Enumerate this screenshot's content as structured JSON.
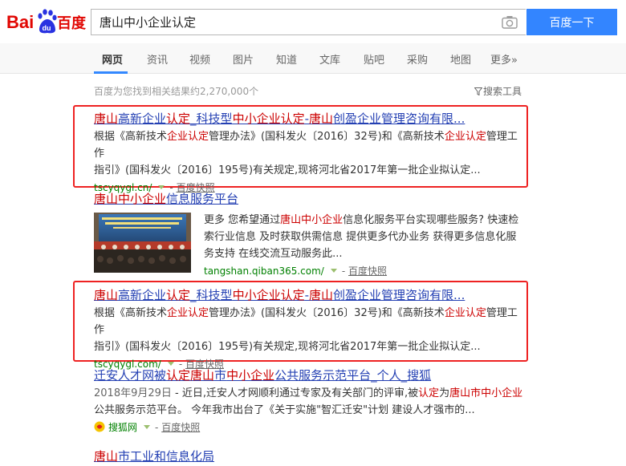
{
  "header": {
    "logo_text_left": "Bai",
    "logo_text_du": "du",
    "logo_text_right": "百度",
    "query": "唐山中小企业认定",
    "search_button": "百度一下"
  },
  "tabs": [
    {
      "label": "网页",
      "active": true
    },
    {
      "label": "资讯"
    },
    {
      "label": "视频"
    },
    {
      "label": "图片"
    },
    {
      "label": "知道"
    },
    {
      "label": "文库"
    },
    {
      "label": "贴吧"
    },
    {
      "label": "采购"
    },
    {
      "label": "地图"
    },
    {
      "label": "更多»"
    }
  ],
  "meta": {
    "result_count": "百度为您找到相关结果约2,270,000个",
    "search_tools": "搜索工具"
  },
  "results": [
    {
      "title_parts": [
        "唐山",
        "高新企业",
        "认定",
        "_科技型",
        "中小企业",
        "认定",
        "-",
        "唐山",
        "创盈企业管理咨询有限..."
      ],
      "abstract_line1": [
        "根据《高新技术",
        "企业认定",
        "管理办法》(国科发火〔2016〕32号)和《高新技术",
        "企业认定",
        "管理工作"
      ],
      "abstract_line2": "指引》(国科发火〔2016〕195号)有关规定,现将河北省2017年第一批企业拟认定...",
      "url": "tscyqygl.cn/",
      "snapshot": "百度快照",
      "sep": "-"
    },
    {
      "title_parts": [
        "唐山中小企业",
        "信息服务平台"
      ],
      "abstract_parts": [
        "更多 您希望通过",
        "唐山中小企业",
        "信息化服务平台实现哪些服务? 快速检索行业信息 及时获取供需信息 提供更多代办业务 获得更多信息化服务支持 在线交流互动服务此..."
      ],
      "url": "tangshan.qiban365.com/",
      "snapshot": "百度快照",
      "sep": "-"
    },
    {
      "title_parts": [
        "唐山",
        "高新企业",
        "认定",
        "_科技型",
        "中小企业",
        "认定",
        "-",
        "唐山",
        "创盈企业管理咨询有限..."
      ],
      "abstract_line1": [
        "根据《高新技术",
        "企业认定",
        "管理办法》(国科发火〔2016〕32号)和《高新技术",
        "企业认定",
        "管理工作"
      ],
      "abstract_line2": "指引》(国科发火〔2016〕195号)有关规定,现将河北省2017年第一批企业拟认定...",
      "url": "tscyqygl.com/",
      "snapshot": "百度快照",
      "sep": "-"
    },
    {
      "title_parts": [
        "迁安人才网被",
        "认定",
        "唐山",
        "市",
        "中小企业",
        "公共服务示范平台_个人_搜狐"
      ],
      "abstract_parts": [
        "2018年9月29日",
        " - 近日,迁安人才网顺利通过专家及有关部门的评审,被",
        "认定",
        "为",
        "唐山市中小企业",
        "公共服务示范平台。 今年我市出台了《关于实施\"智汇迁安\"计划 建设人才强市的..."
      ],
      "source": "搜狐网",
      "snapshot": "百度快照",
      "sep": "-"
    },
    {
      "title_parts": [
        "唐山",
        "市工业和信息化局"
      ]
    }
  ],
  "colors": {
    "link": "#2440b3",
    "highlight": "#cc0000",
    "url_green": "#008000",
    "button_blue": "#3385ff",
    "annotation_red": "#ee2222"
  }
}
